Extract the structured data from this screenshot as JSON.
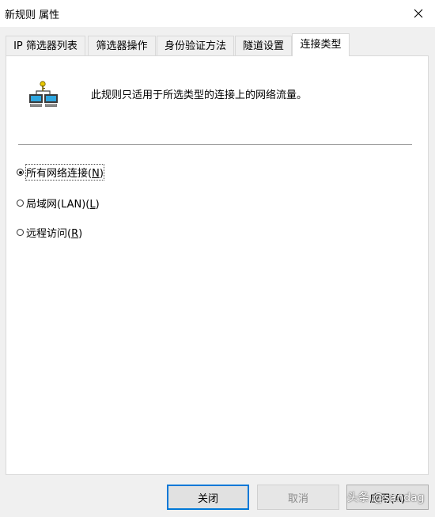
{
  "window": {
    "title": "新规则 属性"
  },
  "tabs": [
    {
      "label": "IP 筛选器列表"
    },
    {
      "label": "筛选器操作"
    },
    {
      "label": "身份验证方法"
    },
    {
      "label": "隧道设置"
    },
    {
      "label": "连接类型",
      "active": true
    }
  ],
  "panel": {
    "description": "此规则只适用于所选类型的连接上的网络流量。",
    "icon": "network-computers-icon",
    "options": [
      {
        "label": "所有网络连接(",
        "key": "N",
        "suffix": ")",
        "selected": true
      },
      {
        "label": "局域网(LAN)(",
        "key": "L",
        "suffix": ")",
        "selected": false
      },
      {
        "label": "远程访问(",
        "key": "R",
        "suffix": ")",
        "selected": false
      }
    ]
  },
  "buttons": {
    "close": "关闭",
    "cancel": "取消",
    "apply": "应用(A)"
  },
  "watermark": "头条 @sandag",
  "colors": {
    "focus_border": "#0078d7",
    "panel_bg": "#ffffff",
    "dialog_bg": "#f0f0f0"
  }
}
